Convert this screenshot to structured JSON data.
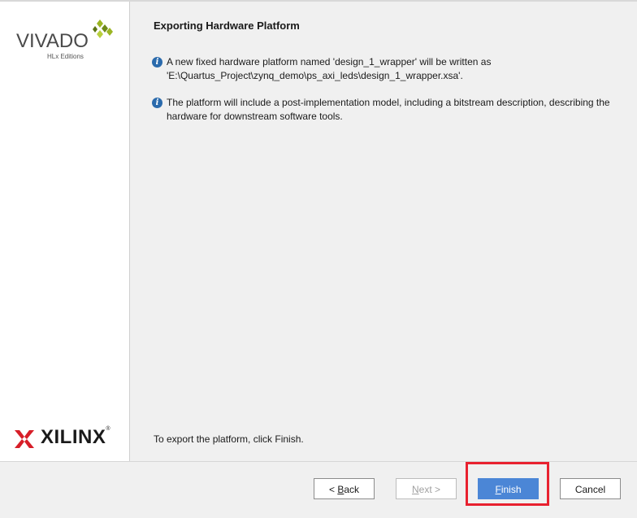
{
  "sidebar": {
    "brand_top": "VIVADO",
    "brand_top_sub": "HLx Editions",
    "brand_bottom": "XILINX",
    "brand_bottom_reg": "®"
  },
  "main": {
    "title": "Exporting Hardware Platform",
    "info_1": "A new fixed hardware platform named 'design_1_wrapper' will be written as 'E:\\Quartus_Project\\zynq_demo\\ps_axi_leds\\design_1_wrapper.xsa'.",
    "info_2": "The platform will include a post-implementation model, including a bitstream description, describing the hardware for downstream software tools.",
    "hint": "To export the platform, click Finish."
  },
  "footer": {
    "back_prefix": "< ",
    "back_mnemonic": "B",
    "back_rest": "ack",
    "next_mnemonic": "N",
    "next_rest": "ext >",
    "finish_mnemonic": "F",
    "finish_rest": "inish",
    "cancel_label": "Cancel"
  },
  "colors": {
    "accent_button": "#4b86d6",
    "highlight_border": "#e8212f",
    "info_icon": "#2a6aac",
    "vivado_leaf": "#9bb523",
    "xilinx_red": "#d71e28"
  },
  "icons": [
    "info-icon",
    "vivado-logo-mark",
    "xilinx-logo-mark"
  ]
}
